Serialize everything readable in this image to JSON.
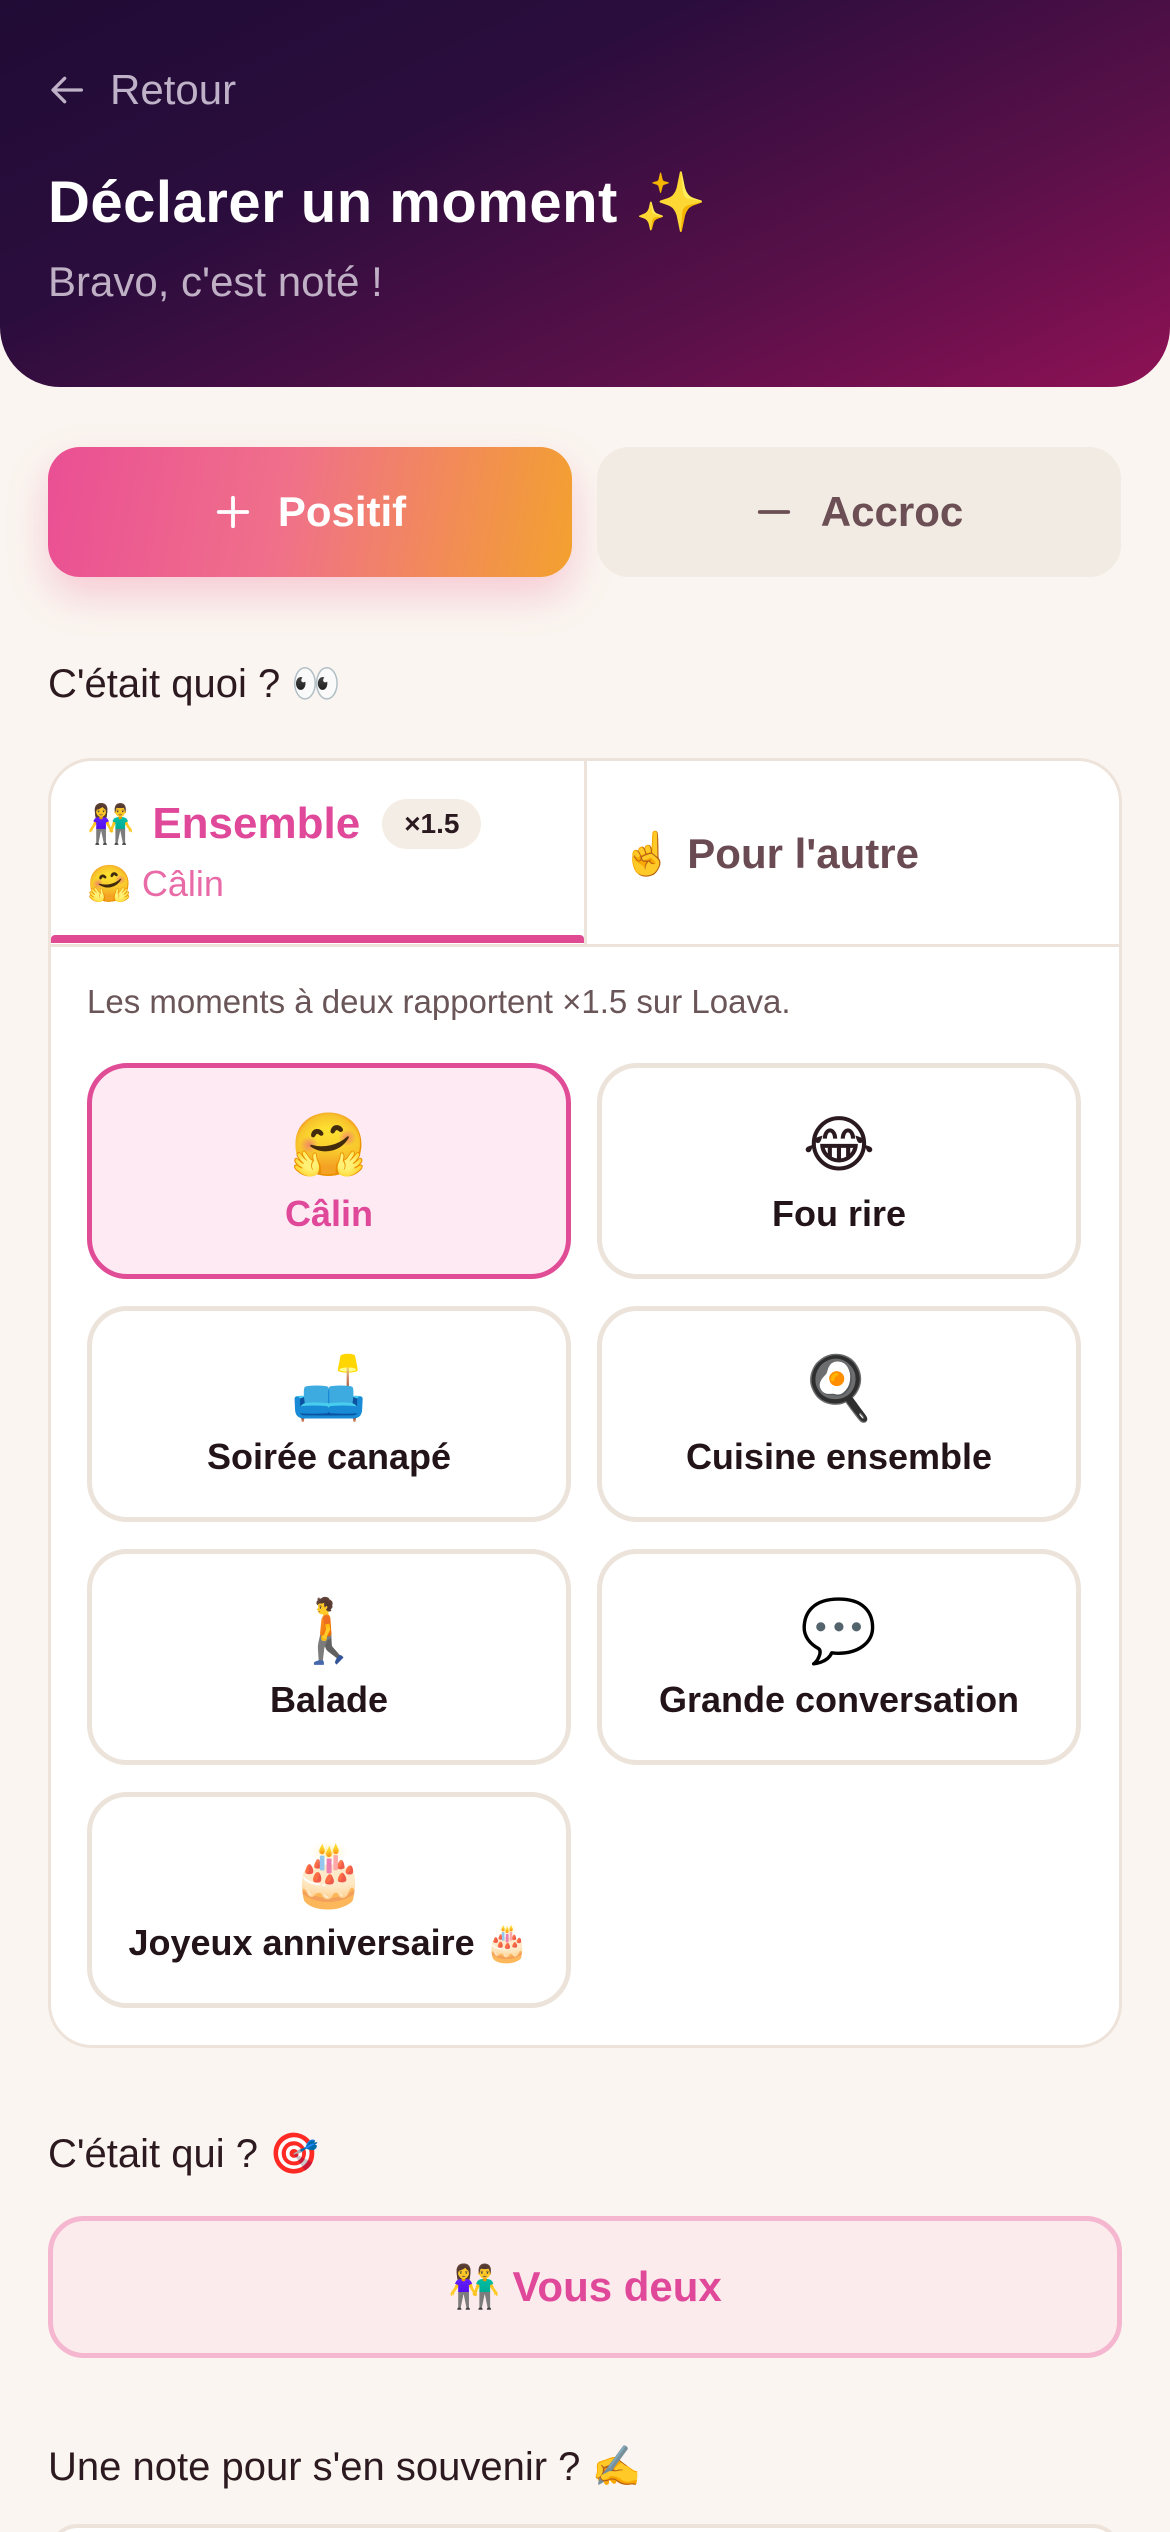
{
  "header": {
    "back_label": "Retour",
    "title": "Déclarer un moment",
    "title_emoji": "✨",
    "subtitle": "Bravo, c'est noté !"
  },
  "type_toggle": {
    "positive_label": "Positif",
    "negative_label": "Accroc",
    "selected": "positive"
  },
  "what_section": {
    "label": "C'était quoi ?",
    "emoji": "👀"
  },
  "tabs": {
    "together": {
      "emoji": "👫",
      "label": "Ensemble",
      "badge": "×1.5",
      "selected_emoji": "🤗",
      "selected_label": "Câlin"
    },
    "other": {
      "emoji": "☝️",
      "label": "Pour l'autre"
    },
    "active": "together"
  },
  "hint": "Les moments à deux rapportent ×1.5 sur Loava.",
  "moments": [
    {
      "emoji": "🤗",
      "label": "Câlin",
      "selected": true
    },
    {
      "emoji": "😂",
      "label": "Fou rire",
      "selected": false
    },
    {
      "emoji": "🛋️",
      "label": "Soirée canapé",
      "selected": false
    },
    {
      "emoji": "🍳",
      "label": "Cuisine ensemble",
      "selected": false
    },
    {
      "emoji": "🚶",
      "label": "Balade",
      "selected": false
    },
    {
      "emoji": "💬",
      "label": "Grande conversation",
      "selected": false
    },
    {
      "emoji": "🎂",
      "label": "Joyeux anniversaire 🎂",
      "selected": false
    }
  ],
  "who_section": {
    "label": "C'était qui ?",
    "emoji": "🎯"
  },
  "who_button": {
    "emoji": "👫",
    "label": "Vous deux"
  },
  "note_section": {
    "label": "Une note pour s'en souvenir ?",
    "emoji": "✍️"
  },
  "colors": {
    "accent": "#e0489a",
    "header_dark": "#200c35",
    "header_magenta": "#8e1155",
    "toggle_orange": "#f3a12f",
    "background": "#faf5f0"
  }
}
